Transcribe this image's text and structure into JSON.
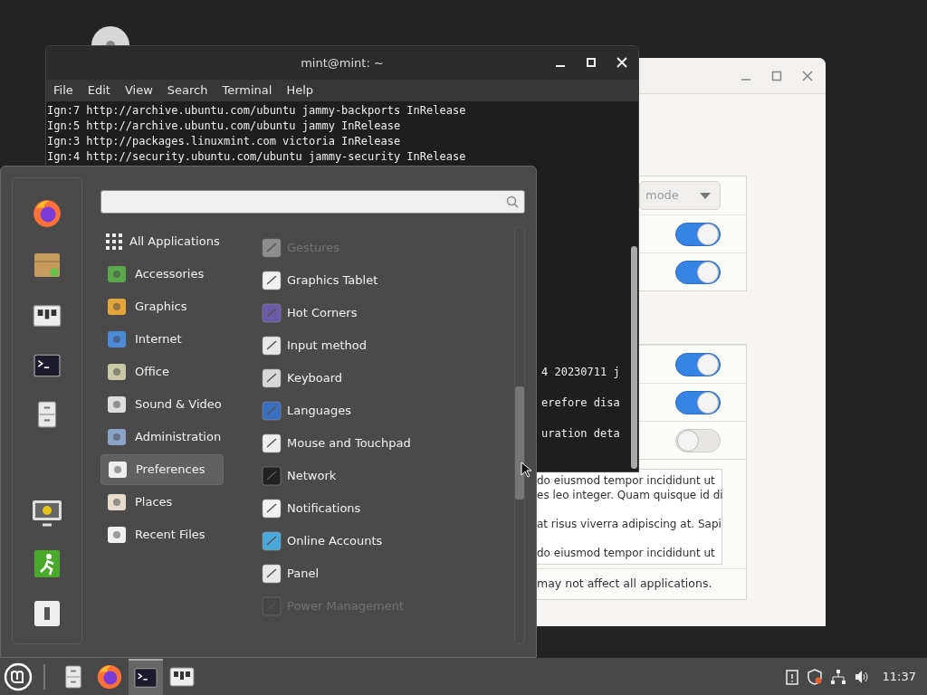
{
  "terminal": {
    "title": "mint@mint: ~",
    "menu": [
      "File",
      "Edit",
      "View",
      "Search",
      "Terminal",
      "Help"
    ],
    "lines": [
      "Ign:7 http://archive.ubuntu.com/ubuntu jammy-backports InRelease",
      "Ign:5 http://archive.ubuntu.com/ubuntu jammy InRelease",
      "Ign:3 http://packages.linuxmint.com victoria InRelease",
      "Ign:4 http://security.ubuntu.com/ubuntu jammy-security InRelease"
    ],
    "partial_lines": [
      "4 20230711 j",
      "erefore disa",
      "uration deta"
    ]
  },
  "settings": {
    "groups": [
      [
        {
          "kind": "dropdown",
          "value": "mode"
        },
        {
          "kind": "switch",
          "on": true
        },
        {
          "kind": "switch",
          "on": true
        }
      ],
      [
        {
          "kind": "switch",
          "on": true
        },
        {
          "kind": "switch",
          "on": true
        },
        {
          "kind": "switch",
          "on": false
        }
      ]
    ],
    "text_lines": [
      "do eiusmod tempor incididunt ut",
      "es leo integer. Quam quisque id di",
      "at risus viverra adipiscing at. Sapi",
      "do eiusmod tempor incididunt ut"
    ],
    "footer": "may not affect all applications."
  },
  "menu": {
    "categories": [
      {
        "label": "All Applications",
        "selected": false
      },
      {
        "label": "Accessories",
        "selected": false
      },
      {
        "label": "Graphics",
        "selected": false
      },
      {
        "label": "Internet",
        "selected": false
      },
      {
        "label": "Office",
        "selected": false
      },
      {
        "label": "Sound & Video",
        "selected": false
      },
      {
        "label": "Administration",
        "selected": false
      },
      {
        "label": "Preferences",
        "selected": true
      },
      {
        "label": "Places",
        "selected": false
      },
      {
        "label": "Recent Files",
        "selected": false
      }
    ],
    "apps": [
      {
        "label": "Gestures",
        "dimmed": true
      },
      {
        "label": "Graphics Tablet",
        "dimmed": false
      },
      {
        "label": "Hot Corners",
        "dimmed": false
      },
      {
        "label": "Input method",
        "dimmed": false
      },
      {
        "label": "Keyboard",
        "dimmed": false
      },
      {
        "label": "Languages",
        "dimmed": false
      },
      {
        "label": "Mouse and Touchpad",
        "dimmed": false
      },
      {
        "label": "Network",
        "dimmed": false
      },
      {
        "label": "Notifications",
        "dimmed": false
      },
      {
        "label": "Online Accounts",
        "dimmed": false
      },
      {
        "label": "Panel",
        "dimmed": false
      },
      {
        "label": "Power Management",
        "dimmed": true
      }
    ]
  },
  "taskbar": {
    "launchers": [
      {
        "kind": "files",
        "active": false
      },
      {
        "kind": "firefox",
        "active": false
      },
      {
        "kind": "terminal",
        "active": true
      },
      {
        "kind": "settings",
        "active": false
      }
    ],
    "clock": "11:37"
  }
}
